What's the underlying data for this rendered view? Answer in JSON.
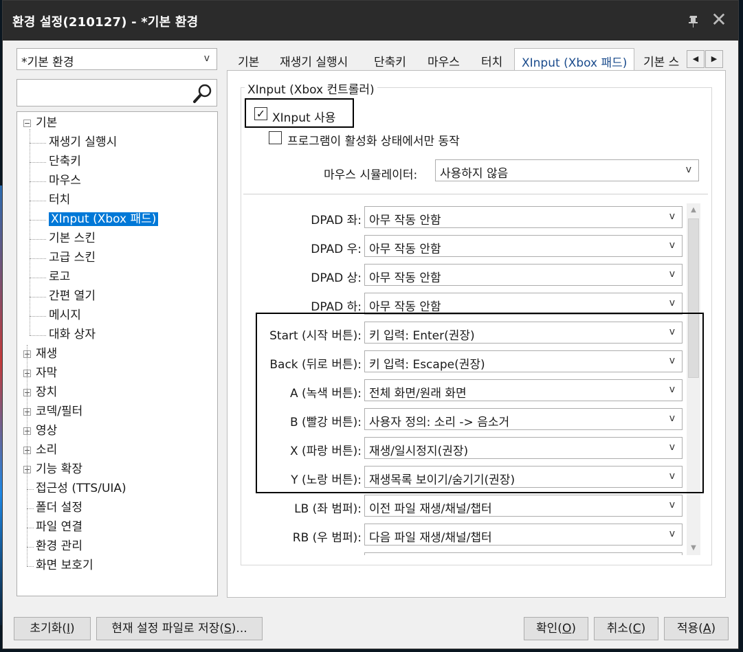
{
  "window": {
    "title": "환경 설정(210127) - *기본 환경",
    "pin_icon": "pin-icon",
    "close_icon": "close-icon"
  },
  "profile": {
    "selected": "*기본 환경",
    "arrow": "v"
  },
  "search": {
    "value": "",
    "icon": "search-icon"
  },
  "tree": {
    "root_basic": "기본",
    "basic_children": [
      "재생기 실행시",
      "단축키",
      "마우스",
      "터치",
      "XInput (Xbox 패드)",
      "기본 스킨",
      "고급 스킨",
      "로고",
      "간편 열기",
      "메시지",
      "대화 상자"
    ],
    "collapsed": [
      "재생",
      "자막",
      "장치",
      "코덱/필터",
      "영상",
      "소리",
      "기능 확장"
    ],
    "leaves": [
      "접근성 (TTS/UIA)",
      "폴더 설정",
      "파일 연결",
      "환경 관리",
      "화면 보호기"
    ],
    "selected_index": 4
  },
  "tabs": [
    "기본",
    "재생기 실행시",
    "단축키",
    "마우스",
    "터치",
    "XInput (Xbox 패드)",
    "기본 스"
  ],
  "active_tab": 5,
  "group": {
    "title": "XInput (Xbox 컨트롤러)",
    "use_xinput": {
      "label": "XInput 사용",
      "checked": true,
      "mark": "✓"
    },
    "active_only": {
      "label": "프로그램이 활성화 상태에서만 동작",
      "checked": false
    },
    "mouse_sim": {
      "label": "마우스 시뮬레이터:",
      "value": "사용하지 않음"
    }
  },
  "mappings": [
    {
      "label": "DPAD 좌:",
      "value": "아무 작동 안함"
    },
    {
      "label": "DPAD 우:",
      "value": "아무 작동 안함"
    },
    {
      "label": "DPAD 상:",
      "value": "아무 작동 안함"
    },
    {
      "label": "DPAD 하:",
      "value": "아무 작동 안함"
    },
    {
      "label": "Start (시작 버튼):",
      "value": "키 입력: Enter(권장)"
    },
    {
      "label": "Back (뒤로 버튼):",
      "value": "키 입력: Escape(권장)"
    },
    {
      "label": "A (녹색 버튼):",
      "value": "전체 화면/원래 화면"
    },
    {
      "label": "B (빨강 버튼):",
      "value": "사용자 정의: 소리 -> 음소거"
    },
    {
      "label": "X (파랑 버튼):",
      "value": "재생/일시정지(권장)"
    },
    {
      "label": "Y (노랑 버튼):",
      "value": "재생목록 보이기/숨기기(권장)"
    },
    {
      "label": "LB (좌 범퍼):",
      "value": "이전 파일 재생/채널/챕터"
    },
    {
      "label": "RB (우 범퍼):",
      "value": "다음 파일 재생/채널/챕터"
    },
    {
      "label": "",
      "value": ""
    }
  ],
  "dropdown_arrow": "v",
  "buttons": {
    "reset": {
      "label": "초기화(",
      "key": "I",
      "tail": ")"
    },
    "save": {
      "label": "현재 설정 파일로 저장(",
      "key": "S",
      "tail": ")..."
    },
    "ok": {
      "label": "확인(",
      "key": "O",
      "tail": ")"
    },
    "cancel": {
      "label": "취소(",
      "key": "C",
      "tail": ")"
    },
    "apply": {
      "label": "적용(",
      "key": "A",
      "tail": ")"
    }
  },
  "colors": {
    "selection": "#0078d7",
    "titlebar": "#2b2b2b",
    "active_tab_text": "#1a4b8c"
  }
}
